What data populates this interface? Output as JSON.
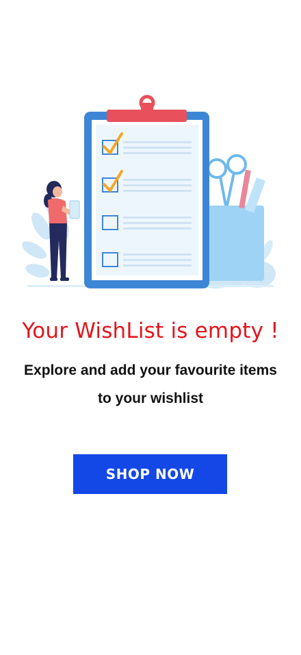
{
  "empty_state": {
    "title": "Your WishList is empty !",
    "message": "Explore and add your favourite  items\nto your wishlist",
    "button_label": "SHOP NOW",
    "illustration_icon": "clipboard-checklist-illustration"
  },
  "colors": {
    "title": "#e3151c",
    "button": "#1347e6",
    "clipboard_frame": "#3d86d6",
    "clip": "#e8505b",
    "check": "#f5a623"
  }
}
